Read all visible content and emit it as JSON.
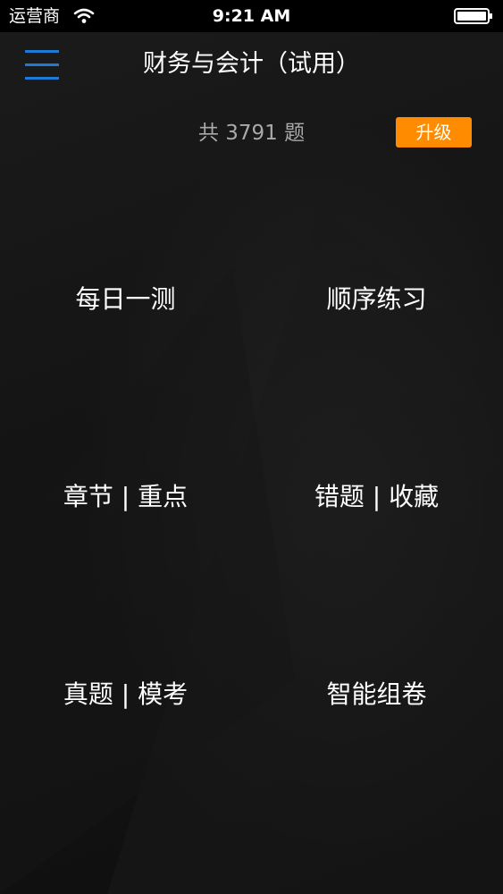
{
  "status_bar": {
    "carrier": "运营商",
    "time": "9:21 AM"
  },
  "nav": {
    "title": "财务与会计（试用）"
  },
  "summary": {
    "prefix": "共",
    "count": "3791",
    "suffix": "题",
    "upgrade_label": "升级"
  },
  "menu": {
    "items": [
      {
        "label": "每日一测"
      },
      {
        "label": "顺序练习"
      },
      {
        "label": "章节 | 重点"
      },
      {
        "label": "错题 | 收藏"
      },
      {
        "label": "真题 | 模考"
      },
      {
        "label": "智能组卷"
      }
    ]
  },
  "colors": {
    "accent_blue": "#1f7ad6",
    "upgrade_orange": "#ff8c00",
    "background": "#121212"
  },
  "icons": {
    "menu": "hamburger-menu-icon",
    "wifi": "wifi-icon",
    "battery": "battery-icon"
  }
}
